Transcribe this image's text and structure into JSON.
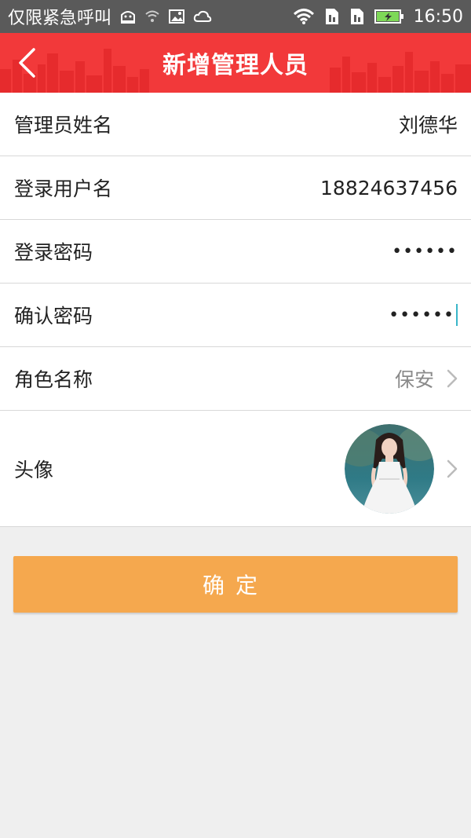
{
  "status_bar": {
    "carrier_text": "仅限紧急呼叫",
    "time": "16:50"
  },
  "header": {
    "title": "新增管理人员"
  },
  "form": {
    "fields": [
      {
        "label": "管理员姓名",
        "value": "刘德华"
      },
      {
        "label": "登录用户名",
        "value": "18824637456"
      },
      {
        "label": "登录密码",
        "value": "••••••"
      },
      {
        "label": "确认密码",
        "value": "••••••"
      },
      {
        "label": "角色名称",
        "value": "保安"
      }
    ],
    "avatar_label": "头像"
  },
  "actions": {
    "confirm_label": "确定"
  },
  "colors": {
    "header_red": "#f2393a",
    "confirm_orange": "#f5a84e",
    "status_bar": "#5a5a5a"
  }
}
